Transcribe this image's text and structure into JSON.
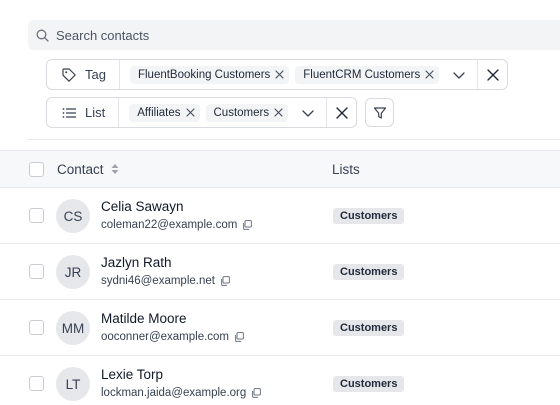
{
  "search": {
    "placeholder": "Search contacts"
  },
  "filters": {
    "tag": {
      "label": "Tag",
      "values": [
        "FluentBooking Customers",
        "FluentCRM Customers"
      ]
    },
    "list": {
      "label": "List",
      "values": [
        "Affiliates",
        "Customers"
      ]
    }
  },
  "table": {
    "columns": {
      "contact": "Contact",
      "lists": "Lists"
    },
    "rows": [
      {
        "initials": "CS",
        "name": "Celia Sawayn",
        "email": "coleman22@example.com",
        "list": "Customers"
      },
      {
        "initials": "JR",
        "name": "Jazlyn Rath",
        "email": "sydni46@example.net",
        "list": "Customers"
      },
      {
        "initials": "MM",
        "name": "Matilde Moore",
        "email": "ooconner@example.com",
        "list": "Customers"
      },
      {
        "initials": "LT",
        "name": "Lexie Torp",
        "email": "lockman.jaida@example.org",
        "list": "Customers"
      }
    ]
  },
  "icons": {
    "search": "search-icon",
    "tag": "tag-icon",
    "list": "list-icon",
    "remove": "close-icon",
    "dropdown": "chevron-down-icon",
    "filter": "funnel-icon",
    "sort": "sort-icon",
    "copy": "copy-icon"
  },
  "colors": {
    "chip_bg": "#f3f4f6",
    "badge_bg": "#e5e7eb",
    "header_bg": "#f7f8fa",
    "border": "#d8dbe0"
  }
}
